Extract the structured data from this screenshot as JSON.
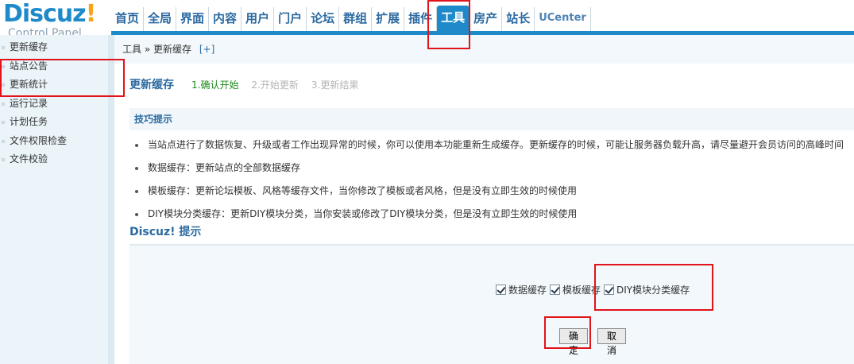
{
  "logo": {
    "brand": "Discuz",
    "bang": "!",
    "sub": "Control Panel"
  },
  "nav": {
    "items": [
      "首页",
      "全局",
      "界面",
      "内容",
      "用户",
      "门户",
      "论坛",
      "群组",
      "扩展",
      "插件",
      "工具",
      "房产",
      "站长",
      "UCenter"
    ],
    "active_index": 10
  },
  "sidebar": {
    "items": [
      "更新缓存",
      "站点公告",
      "更新统计",
      "运行记录",
      "计划任务",
      "文件权限检查",
      "文件校验"
    ],
    "active_index": 0
  },
  "breadcrumb": {
    "section": "工具",
    "sep": "»",
    "current": "更新缓存",
    "plus": "[+]"
  },
  "steps": {
    "title": "更新缓存",
    "items": [
      "1.确认开始",
      "2.开始更新",
      "3.更新结果"
    ],
    "current_index": 0
  },
  "tips": {
    "heading": "技巧提示",
    "items": [
      "当站点进行了数据恢复、升级或者工作出现异常的时候，你可以使用本功能重新生成缓存。更新缓存的时候，可能让服务器负载升高，请尽量避开会员访问的高峰时间",
      "数据缓存：更新站点的全部数据缓存",
      "模板缓存：更新论坛模板、风格等缓存文件，当你修改了模板或者风格，但是没有立即生效的时候使用",
      "DIY模块分类缓存：更新DIY模块分类，当你安装或修改了DIY模块分类，但是没有立即生效的时候使用"
    ]
  },
  "prompt": {
    "title": "Discuz! 提示"
  },
  "form": {
    "checkboxes": [
      {
        "label": "数据缓存",
        "checked": true
      },
      {
        "label": "模板缓存",
        "checked": true
      },
      {
        "label": "DIY模块分类缓存",
        "checked": true
      }
    ],
    "ok_label": "确定",
    "cancel_label": "取消"
  },
  "colors": {
    "accent": "#1e8ac9",
    "highlight": "#e0141a",
    "current_step": "#1c8a1c"
  }
}
